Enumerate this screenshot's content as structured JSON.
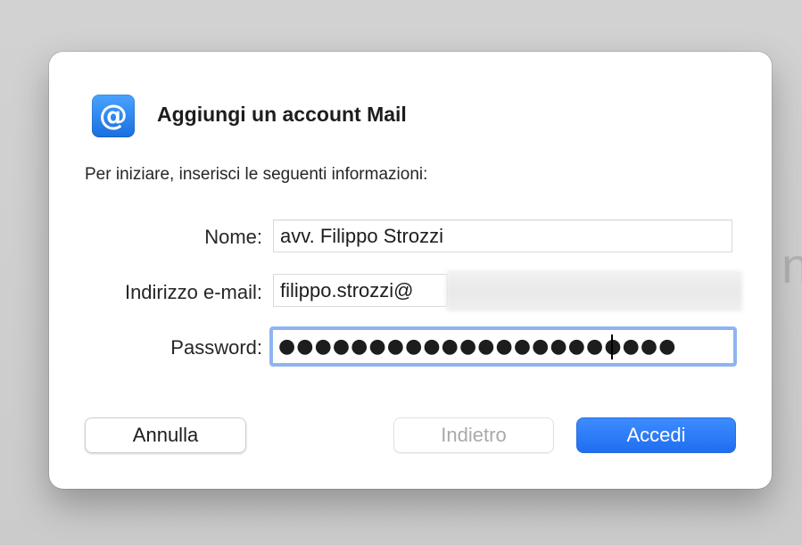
{
  "background": {
    "glyph": "n"
  },
  "dialog": {
    "icon": {
      "name": "at-sign-mail-icon",
      "glyph": "@",
      "color": "#1a6fe0"
    },
    "title": "Aggiungi un account Mail",
    "intro": "Per iniziare, inserisci le seguenti informazioni:",
    "fields": {
      "name": {
        "label": "Nome:",
        "value": "avv. Filippo Strozzi"
      },
      "email": {
        "label": "Indirizzo e-mail:",
        "value": "filippo.strozzi@"
      },
      "password": {
        "label": "Password:",
        "value_masked": "●●●●●●●●●●●●●●●●●●●●●●"
      }
    },
    "buttons": {
      "cancel": "Annulla",
      "back": "Indietro",
      "login": "Accedi"
    },
    "colors": {
      "accent": "#1f6ef0",
      "focus_ring": "#8fb5f0",
      "disabled_text": "#a9a9a9"
    }
  }
}
